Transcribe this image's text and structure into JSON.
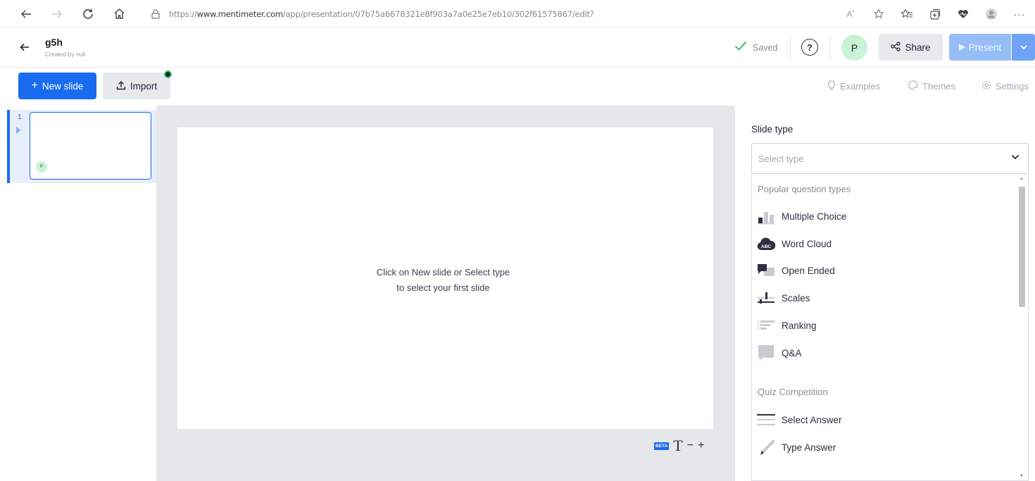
{
  "browser": {
    "url_prefix": "https://",
    "url_domain": "www.mentimeter.com",
    "url_path": "/app/presentation/07b75a6678321e8f903a7a0e25e7eb10/302f61575867/edit?"
  },
  "header": {
    "title": "g5h",
    "subtitle": "Created by null",
    "saved_label": "Saved",
    "avatar_initial": "P",
    "share_label": "Share",
    "present_label": "Present"
  },
  "toolbar": {
    "new_slide_label": "New slide",
    "import_label": "Import",
    "examples_label": "Examples",
    "themes_label": "Themes",
    "settings_label": "Settings"
  },
  "slides": [
    {
      "number": "1",
      "avatar_initial": "P"
    }
  ],
  "canvas": {
    "message_line1": "Click on New slide or Select type",
    "message_line2": "to select your first slide",
    "beta_label": "BETA",
    "text_tool": "T",
    "minus": "−",
    "plus": "+"
  },
  "panel": {
    "heading": "Slide type",
    "select_placeholder": "Select type",
    "popular_section": "Popular question types",
    "popular_items": [
      {
        "label": "Multiple Choice",
        "icon": "bar-chart-icon"
      },
      {
        "label": "Word Cloud",
        "icon": "word-cloud-icon"
      },
      {
        "label": "Open Ended",
        "icon": "speech-bubbles-icon"
      },
      {
        "label": "Scales",
        "icon": "scales-icon"
      },
      {
        "label": "Ranking",
        "icon": "ranking-icon"
      },
      {
        "label": "Q&A",
        "icon": "qa-bubble-icon"
      }
    ],
    "quiz_section": "Quiz Competition",
    "quiz_items": [
      {
        "label": "Select Answer",
        "icon": "lines-icon"
      },
      {
        "label": "Type Answer",
        "icon": "pencil-icon"
      }
    ]
  },
  "colors": {
    "accent": "#196cf0",
    "present_button": "#96bdf7",
    "saved_check": "#39b55e",
    "avatar_bg": "#c9f3d6",
    "canvas_bg": "#e6e7ea"
  }
}
